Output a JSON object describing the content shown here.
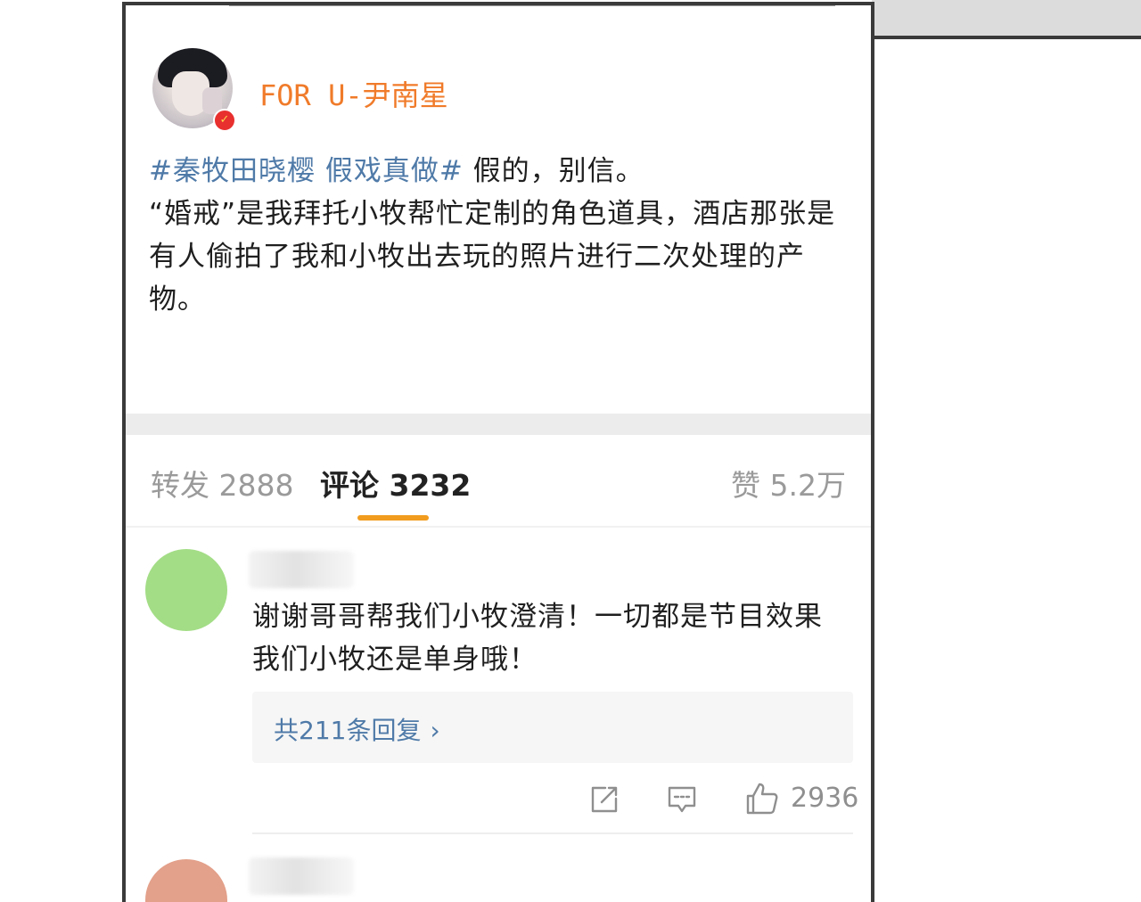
{
  "post": {
    "username": "FOR U-尹南星",
    "hashtag": "#秦牧田晓樱 假戏真做#",
    "body_first_line": " 假的，别信。",
    "body_rest": "“婚戒”是我拜托小牧帮忙定制的角色道具，酒店那张是有人偷拍了我和小牧出去玩的照片进行二次处理的产物。"
  },
  "tabs": {
    "repost": "转发 2888",
    "comments": "评论 3232",
    "likes": "赞 5.2万"
  },
  "comment": {
    "text": "谢谢哥哥帮我们小牧澄清！一切都是节目效果我们小牧还是单身哦！",
    "replies": "共211条回复",
    "replies_chevron": "›",
    "like_count": "2936"
  },
  "icons": {
    "verified": "verified-badge-icon",
    "share": "share-icon",
    "comment": "comment-icon",
    "like": "thumbs-up-icon"
  },
  "colors": {
    "username": "#f07b2a",
    "hashtag": "#4f7aa8",
    "tab_underline": "#f19c1e",
    "verified_badge": "#e8302f",
    "comment_avatar": "#a3dd86",
    "comment_avatar_2": "#e3a08a"
  }
}
